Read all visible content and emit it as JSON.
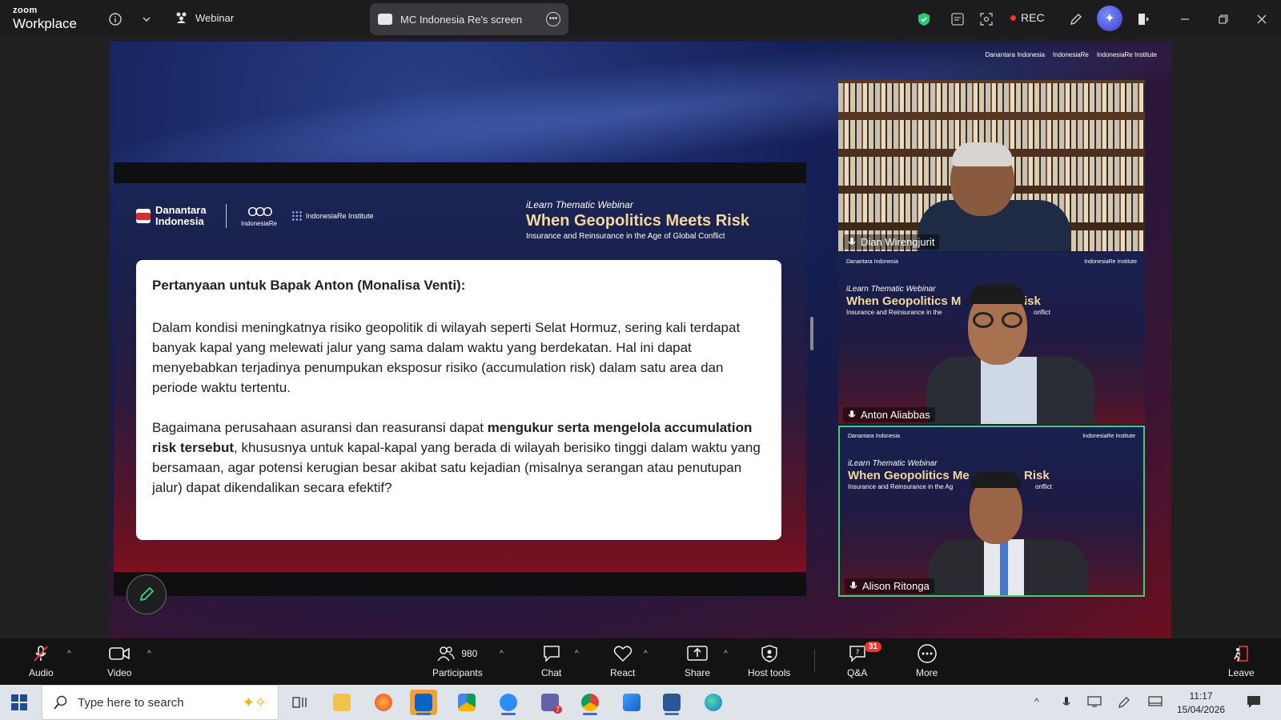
{
  "titlebar": {
    "logo_line1": "zoom",
    "logo_line2": "Workplace",
    "mode_label": "Webinar",
    "share_label": "MC Indonesia Re's screen",
    "rec_label": "REC"
  },
  "slide": {
    "brand_danantara": "Danantara Indonesia",
    "brand_indonesiare": "IndonesiaRe",
    "brand_institute": "IndonesiaRe Institute",
    "kicker": "iLearn Thematic Webinar",
    "title": "When Geopolitics Meets Risk",
    "subtitle": "Insurance and Reinsurance in the Age of Global Conflict",
    "question_title": "Pertanyaan untuk Bapak Anton (Monalisa Venti):",
    "para1": "Dalam kondisi meningkatnya risiko geopolitik di wilayah seperti Selat Hormuz, sering kali terdapat banyak kapal yang melewati jalur yang sama dalam waktu yang berdekatan. Hal ini dapat menyebabkan terjadinya penumpukan eksposur risiko (accumulation risk) dalam satu area dan periode waktu tertentu.",
    "para2_pre": "Bagaimana perusahaan asuransi dan reasuransi dapat ",
    "para2_bold": "mengukur serta mengelola accumulation risk tersebut",
    "para2_post": ", khususnya untuk kapal-kapal yang berada di wilayah berisiko tinggi dalam waktu yang bersamaan, agar potensi kerugian besar akibat satu kejadian (misalnya serangan atau penutupan jalur) dapat dikendalikan secara efektif?"
  },
  "participants_tiles": [
    {
      "name": "Dian Wirengjurit"
    },
    {
      "name": "Anton Aliabbas",
      "kicker": "iLearn Thematic Webinar",
      "title": "When Geopolitics M",
      "title_tail": "isk",
      "sub": "Insurance and Reinsurance in the",
      "sub_tail": "onflict"
    },
    {
      "name": "Alison Ritonga",
      "kicker": "iLearn Thematic Webinar",
      "title": "When Geopolitics Me",
      "title_tail": "Risk",
      "sub": "Insurance and Reinsurance in the Ag",
      "sub_tail": "onflict"
    }
  ],
  "toolbar": {
    "audio": "Audio",
    "video": "Video",
    "participants": "Participants",
    "participants_count": "980",
    "chat": "Chat",
    "react": "React",
    "share": "Share",
    "host_tools": "Host tools",
    "qa": "Q&A",
    "qa_badge": "31",
    "more": "More",
    "leave": "Leave"
  },
  "taskbar": {
    "search_placeholder": "Type here to search",
    "time": "11:17",
    "date": "15/04/2026",
    "teams_badge": "7"
  },
  "colors": {
    "accent_green": "#3fcf7a",
    "rec_red": "#e53935",
    "slide_title": "#f3d8a0"
  }
}
